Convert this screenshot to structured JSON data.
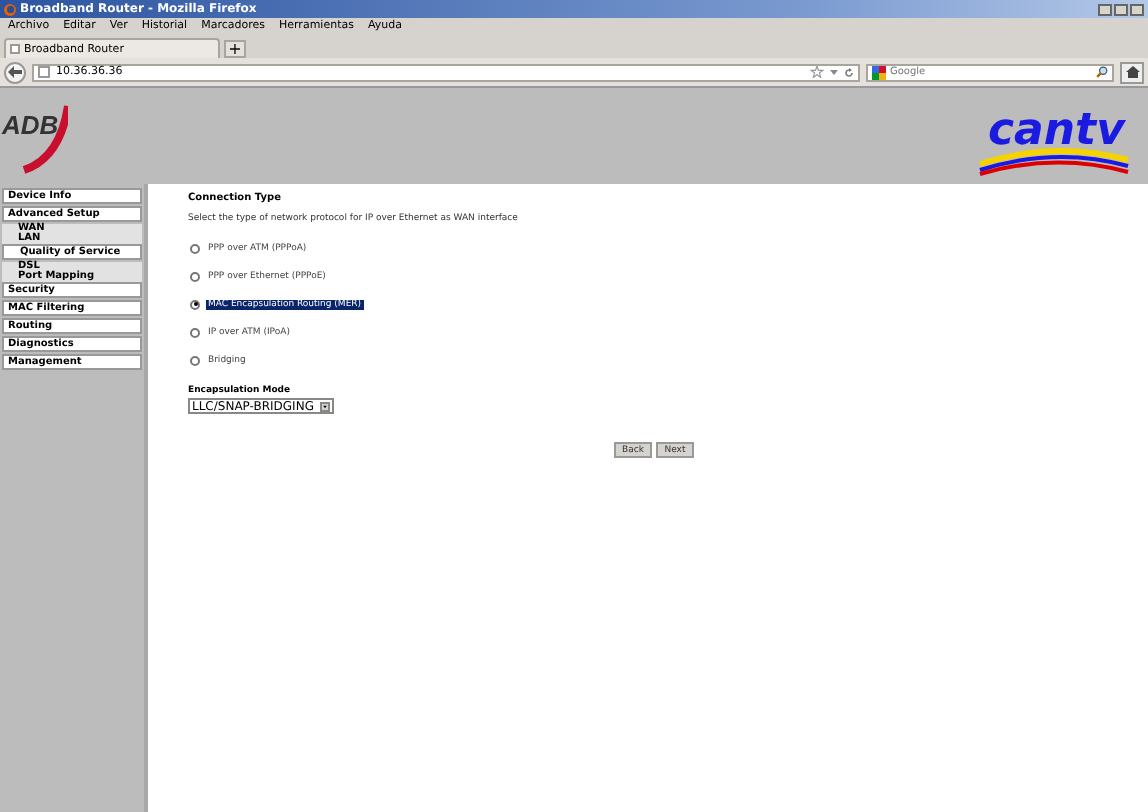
{
  "window": {
    "title": "Broadband Router - Mozilla Firefox"
  },
  "menu": [
    "Archivo",
    "Editar",
    "Ver",
    "Historial",
    "Marcadores",
    "Herramientas",
    "Ayuda"
  ],
  "tabs": [
    {
      "label": "Broadband Router",
      "selected": true
    }
  ],
  "new_tab_button": "+",
  "address_bar": {
    "value": "10.36.36.36"
  },
  "search": {
    "placeholder": "Google"
  },
  "header": {
    "left_logo": "ADB",
    "right_logo": "cantv"
  },
  "sidebar": {
    "items": [
      {
        "label": "Device Info"
      },
      {
        "label": "Advanced Setup",
        "children": [
          {
            "label": "WAN",
            "selected": false
          },
          {
            "label": "LAN",
            "selected": false
          },
          {
            "label": "Quality of Service",
            "selected": true
          },
          {
            "label": "DSL",
            "selected": false
          },
          {
            "label": "Port Mapping",
            "selected": false
          }
        ]
      },
      {
        "label": "Security"
      },
      {
        "label": "MAC Filtering"
      },
      {
        "label": "Routing"
      },
      {
        "label": "Diagnostics"
      },
      {
        "label": "Management"
      }
    ]
  },
  "content": {
    "heading": "Connection Type",
    "description": "Select the type of network protocol for IP over Ethernet as WAN interface",
    "options": [
      {
        "label": "PPP over ATM (PPPoA)",
        "selected": false,
        "highlighted": false
      },
      {
        "label": "PPP over Ethernet (PPPoE)",
        "selected": false,
        "highlighted": false
      },
      {
        "label": "MAC Encapsulation Routing (MER)",
        "selected": true,
        "highlighted": true
      },
      {
        "label": "IP over ATM (IPoA)",
        "selected": false,
        "highlighted": false
      },
      {
        "label": "Bridging",
        "selected": false,
        "highlighted": false
      }
    ],
    "encapsulation": {
      "label": "Encapsulation Mode",
      "value": "LLC/SNAP-BRIDGING"
    },
    "buttons": [
      "Back",
      "Next"
    ]
  }
}
